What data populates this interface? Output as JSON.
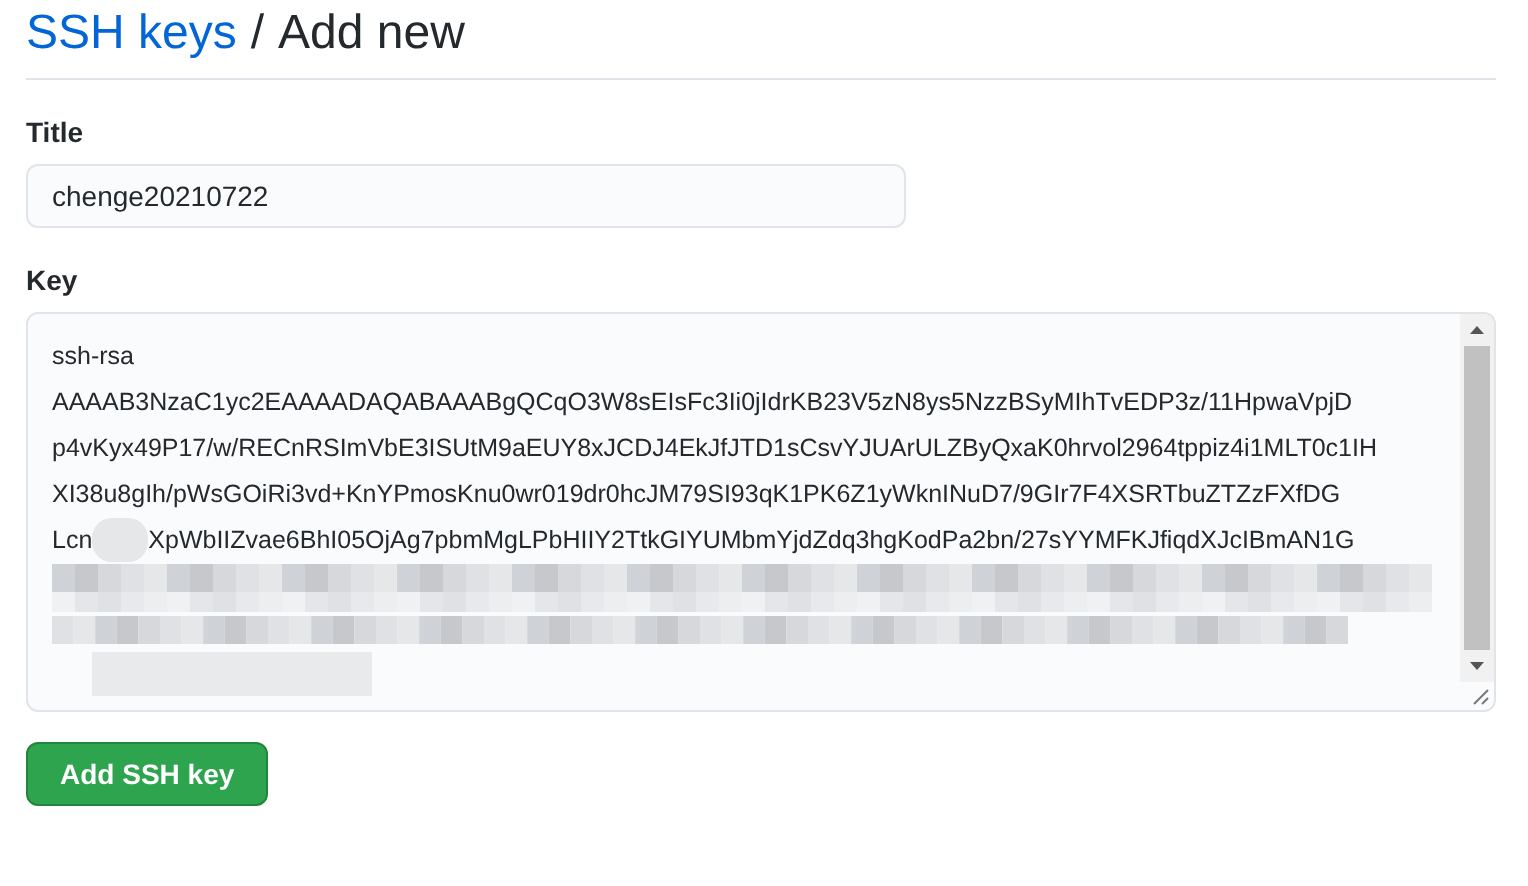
{
  "breadcrumb": {
    "link": "SSH keys",
    "separator": "/",
    "current": "Add new"
  },
  "title_field": {
    "label": "Title",
    "value": "chenge20210722"
  },
  "key_field": {
    "label": "Key",
    "lines": [
      "ssh-rsa",
      "AAAAB3NzaC1yc2EAAAADAQABAAABgQCqO3W8sEIsFc3Ii0jIdrKB23V5zN8ys5NzzBSyMIhTvEDP3z/11HpwaVpjD",
      "p4vKyx49P17/w/RECnRSImVbE3ISUtM9aEUY8xJCDJ4EkJfJTD1sCsvYJUArULZByQxaK0hrvol2964tppiz4i1MLT0c1IH",
      "XI38u8gIh/pWsGOiRi3vd+KnYPmosKnu0wr019dr0hcJM79SI93qK1PK6Z1yWknINuD7/9GIr7F4XSRTbuZTZzFXfDG"
    ],
    "partial_line": {
      "start": "Lcn",
      "end": "XpWbIIZvae6BhI05OjAg7pbmMgLPbHIIY2TtkGIYUMbmYjdZdq3hgKodPa2bn/27sYYMFKJfiqdXJcIBmAN1G"
    }
  },
  "submit_button": "Add SSH key"
}
